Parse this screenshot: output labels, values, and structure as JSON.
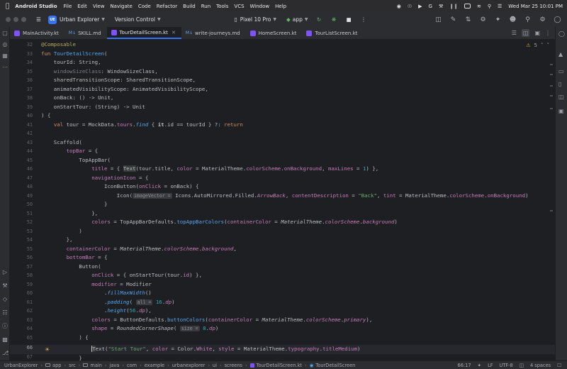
{
  "menubar": {
    "app_name": "Android Studio",
    "menus": [
      "File",
      "Edit",
      "View",
      "Navigate",
      "Code",
      "Refactor",
      "Build",
      "Run",
      "Tools",
      "VCS",
      "Window",
      "Help"
    ],
    "clock": "Wed Mar 25  10:01 PM"
  },
  "toolbar": {
    "project_badge": "UE",
    "project_name": "Urban Explorer",
    "vcs_label": "Version Control",
    "device": "Pixel 10 Pro",
    "run_config": "app"
  },
  "tabs": [
    {
      "label": "MainActivity.kt",
      "type": "kotlin",
      "active": false
    },
    {
      "label": "SKILL.md",
      "type": "markdown",
      "active": false
    },
    {
      "label": "TourDetailScreen.kt",
      "type": "kotlin",
      "active": true
    },
    {
      "label": "write-journeys.md",
      "type": "markdown",
      "active": false
    },
    {
      "label": "HomeScreen.kt",
      "type": "kotlin",
      "active": false
    },
    {
      "label": "TourListScreen.kt",
      "type": "kotlin",
      "active": false
    }
  ],
  "editor": {
    "warnings": "5",
    "current_line": 66,
    "line_numbers": [
      32,
      33,
      34,
      35,
      36,
      37,
      38,
      39,
      40,
      41,
      42,
      43,
      44,
      45,
      46,
      47,
      48,
      49,
      50,
      51,
      52,
      53,
      54,
      55,
      56,
      57,
      58,
      59,
      60,
      61,
      62,
      63,
      64,
      65,
      66,
      67
    ]
  },
  "code": {
    "l32": "@Composable",
    "l33_kw": "fun ",
    "l33_fn": "TourDetailScreen",
    "l33_rest": "(",
    "l34": "    tourId: String,",
    "l35_dim": "    windowSizeClass",
    "l35_rest": ": WindowSizeClass,",
    "l36": "    sharedTransitionScope: SharedTransitionScope,",
    "l37": "    animatedVisibilityScope: AnimatedVisibilityScope,",
    "l38": "    onBack: () -> Unit,",
    "l39": "    onStartTour: (String) -> Unit",
    "l40": ") {",
    "l41_a": "    ",
    "l41_kw": "val",
    "l41_b": " tour = MockData.",
    "l41_c": "tours",
    "l41_d": ".",
    "l41_e": "find",
    "l41_f": " { ",
    "l41_g": "it",
    "l41_h": ".id == tourId } ?: ",
    "l41_ret": "return",
    "l43": "    Scaffold(",
    "l44_pa": "        topBar",
    "l44_rest": " = {",
    "l45": "            TopAppBar(",
    "l46_pa": "                title",
    "l46_b": " = { ",
    "l46_txt": "Text",
    "l46_c": "(tour.title, ",
    "l46_pa2": "color",
    "l46_d": " = MaterialTheme.",
    "l46_cs": "colorScheme",
    "l46_e": ".",
    "l46_ob": "onBackground",
    "l46_f": ", ",
    "l46_ml": "maxLines",
    "l46_g": " = ",
    "l46_n": "1",
    "l46_h": ") },",
    "l47_pa": "                navigationIcon",
    "l47_rest": " = {",
    "l48_a": "                    IconButton(",
    "l48_pa": "onClick",
    "l48_b": " = onBack) {",
    "l49_a": "                        Icon(",
    "l49_hint": "imageVector =",
    "l49_b": " Icons.AutoMirrored.Filled.",
    "l49_ab": "ArrowBack",
    "l49_c": ", ",
    "l49_cd": "contentDescription",
    "l49_d": " = ",
    "l49_str": "\"Back\"",
    "l49_e": ", ",
    "l49_tint": "tint",
    "l49_f": " = MaterialTheme.",
    "l49_cs": "colorScheme",
    "l49_g": ".",
    "l49_ob": "onBackground",
    "l49_h": ")",
    "l50": "                    }",
    "l51": "                },",
    "l52_pa": "                colors",
    "l52_b": " = TopAppBarDefaults.",
    "l52_fn": "topAppBarColors",
    "l52_c": "(",
    "l52_pa2": "containerColor",
    "l52_d": " = ",
    "l52_mt": "MaterialTheme",
    "l52_e": ".",
    "l52_cs": "colorScheme",
    "l52_f": ".",
    "l52_bg": "background",
    "l52_g": ")",
    "l53": "            )",
    "l54": "        },",
    "l55_pa": "        containerColor",
    "l55_b": " = ",
    "l55_mt": "MaterialTheme",
    "l55_c": ".",
    "l55_cs": "colorScheme",
    "l55_d": ".",
    "l55_bg": "background",
    "l55_e": ",",
    "l56_pa": "        bottomBar",
    "l56_rest": " = {",
    "l57": "            Button(",
    "l58_pa": "                onClick",
    "l58_b": " = { onStartTour(tour.",
    "l58_id": "id",
    "l58_c": ") },",
    "l59_pa": "                modifier",
    "l59_rest": " = Modifier",
    "l60_a": "                    .",
    "l60_fn": "fillMaxWidth",
    "l60_b": "()",
    "l61_a": "                    .",
    "l61_fn": "padding",
    "l61_b": "( ",
    "l61_hint": "all =",
    "l61_c": " ",
    "l61_n": "16",
    "l61_d": ".",
    "l61_dp": "dp",
    "l61_e": ")",
    "l62_a": "                    .",
    "l62_fn": "height",
    "l62_b": "(",
    "l62_n": "56",
    "l62_c": ".",
    "l62_dp": "dp",
    "l62_d": "),",
    "l63_pa": "                colors",
    "l63_b": " = ButtonDefaults.",
    "l63_fn": "buttonColors",
    "l63_c": "(",
    "l63_pa2": "containerColor",
    "l63_d": " = ",
    "l63_mt": "MaterialTheme",
    "l63_e": ".",
    "l63_cs": "colorScheme",
    "l63_f": ".",
    "l63_pr": "primary",
    "l63_g": "),",
    "l64_pa": "                shape",
    "l64_b": " = ",
    "l64_fn": "RoundedCornerShape",
    "l64_c": "( ",
    "l64_hint": "size =",
    "l64_d": " ",
    "l64_n": "8",
    "l64_e": ".",
    "l64_dp": "dp",
    "l64_f": ")",
    "l65": "            ) {",
    "l66_a": "                ",
    "l66_t": "T",
    "l66_b": "ext(",
    "l66_str": "\"Start Tour\"",
    "l66_c": ", ",
    "l66_pa": "color",
    "l66_d": " = Color.",
    "l66_w": "White",
    "l66_e": ", ",
    "l66_pa2": "style",
    "l66_f": " = MaterialTheme.",
    "l66_ty": "typography",
    "l66_g": ".",
    "l66_tm": "titleMedium",
    "l66_h": ")",
    "l67": "            }"
  },
  "status": {
    "breadcrumbs": [
      "UrbanExplorer",
      "app",
      "src",
      "main",
      "java",
      "com",
      "example",
      "urbanexplorer",
      "ui",
      "screens",
      "TourDetailScreen.kt",
      "TourDetailScreen"
    ],
    "cursor_pos": "66:17",
    "line_sep": "LF",
    "encoding": "UTF-8",
    "indent": "4 spaces"
  },
  "colors": {
    "accent": "#3574f0",
    "editor_bg": "#1e1f22",
    "panel_bg": "#2b2d30",
    "keyword": "#cf8e6d",
    "function": "#56a8f5",
    "string": "#6aab73",
    "number": "#2aacb8",
    "parameter": "#c77dbb",
    "annotation": "#b3ae60"
  }
}
